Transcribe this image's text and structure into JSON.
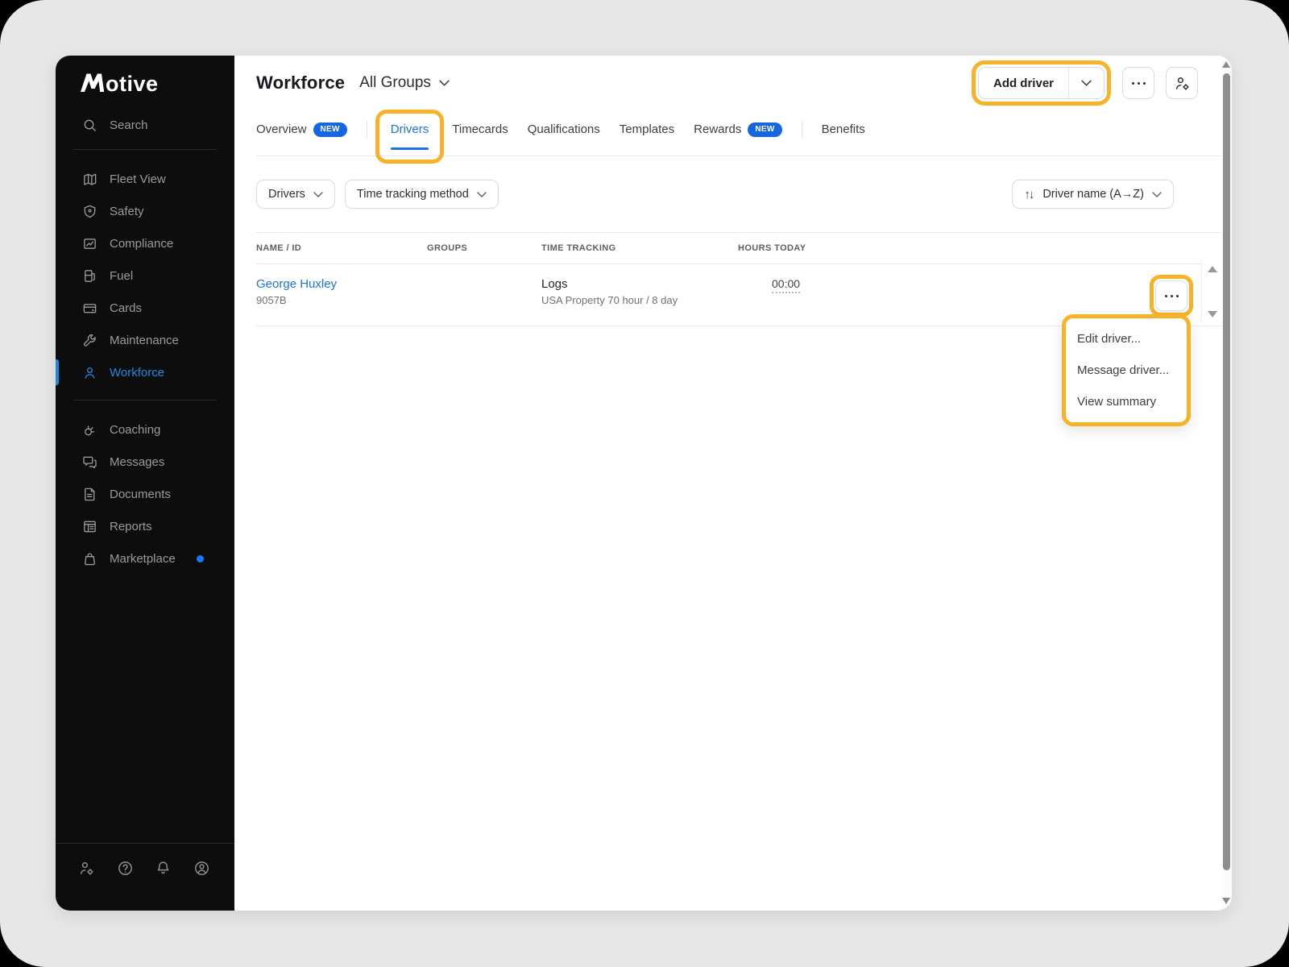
{
  "brand": {
    "name": "motive",
    "logo_suffix": "otive"
  },
  "sidebar": {
    "search": {
      "label": "Search"
    },
    "items": [
      {
        "label": "Fleet View"
      },
      {
        "label": "Safety"
      },
      {
        "label": "Compliance"
      },
      {
        "label": "Fuel"
      },
      {
        "label": "Cards"
      },
      {
        "label": "Maintenance"
      },
      {
        "label": "Workforce",
        "active": true
      },
      {
        "label": "Coaching"
      },
      {
        "label": "Messages"
      },
      {
        "label": "Documents"
      },
      {
        "label": "Reports"
      },
      {
        "label": "Marketplace",
        "notification_dot": true
      }
    ]
  },
  "header": {
    "title": "Workforce",
    "group_scope": "All Groups",
    "add_driver_label": "Add driver"
  },
  "tabs": [
    {
      "label": "Overview",
      "badge": "NEW"
    },
    {
      "label": "Drivers",
      "active": true,
      "highlighted": true
    },
    {
      "label": "Timecards"
    },
    {
      "label": "Qualifications"
    },
    {
      "label": "Templates"
    },
    {
      "label": "Rewards",
      "badge": "NEW"
    },
    {
      "label": "Benefits"
    }
  ],
  "filters": {
    "drivers_label": "Drivers",
    "time_tracking_label": "Time tracking method",
    "sort_glyph": "↑↓",
    "sort_label": "Driver name (A→Z)"
  },
  "table": {
    "columns": [
      "NAME / ID",
      "GROUPS",
      "TIME TRACKING",
      "HOURS TODAY"
    ],
    "rows": [
      {
        "name": "George Huxley",
        "id": "9057B",
        "groups": "",
        "time_tracking_primary": "Logs",
        "time_tracking_secondary": "USA Property 70 hour / 8 day",
        "hours_today": "00:00"
      }
    ]
  },
  "row_menu": {
    "items": [
      "Edit driver...",
      "Message driver...",
      "View summary"
    ]
  },
  "colors": {
    "highlight": "#F8B227",
    "primary_blue": "#1A73E8",
    "badge_blue": "#1566E0",
    "sidebar_active_blue": "#1E88E5",
    "marketplace_dot": "#1677FF"
  }
}
